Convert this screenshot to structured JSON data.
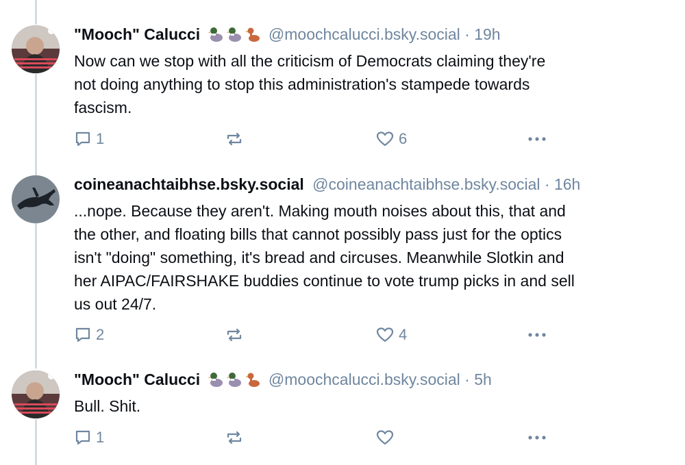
{
  "posts": [
    {
      "display_name": "\"Mooch\" Calucci",
      "emojis": [
        "duck-icon",
        "duck-icon",
        "duck-icon"
      ],
      "handle": "@moochcalucci.bsky.social",
      "separator": "·",
      "time": "19h",
      "text_lines": [
        "Now can we stop with all the criticism of Democrats claiming they're",
        "not doing anything to stop this administration's stampede towards",
        "fascism."
      ],
      "reply_count": "1",
      "repost_count": "",
      "like_count": "6"
    },
    {
      "display_name": "coineanachtaibhse.bsky.social",
      "emojis": [],
      "handle": "@coineanachtaibhse.bsky.social",
      "separator": "·",
      "time": "16h",
      "text_lines": [
        "...nope. Because they aren't. Making mouth noises about this, that and",
        "the other, and floating bills that cannot possibly pass just for the optics",
        "isn't \"doing\" something, it's bread and circuses. Meanwhile Slotkin and",
        "her AIPAC/FAIRSHAKE buddies continue to vote trump picks in and sell",
        "us out 24/7."
      ],
      "reply_count": "2",
      "repost_count": "",
      "like_count": "4"
    },
    {
      "display_name": "\"Mooch\" Calucci",
      "emojis": [
        "duck-icon",
        "duck-icon",
        "duck-icon"
      ],
      "handle": "@moochcalucci.bsky.social",
      "separator": "·",
      "time": "5h",
      "text_lines": [
        "Bull. Shit."
      ],
      "reply_count": "1",
      "repost_count": "",
      "like_count": ""
    }
  ],
  "colors": {
    "text": "#0b0f14",
    "muted": "#6f869f",
    "thread_line": "#d4dbe2"
  },
  "icons": {
    "reply": "reply-icon",
    "repost": "repost-icon",
    "like": "heart-icon",
    "more": "more-icon"
  }
}
